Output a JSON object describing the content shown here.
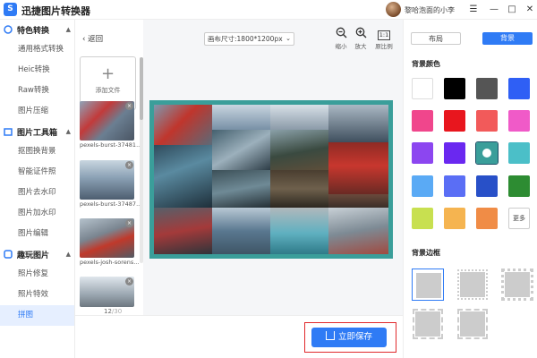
{
  "app": {
    "title": "迅捷图片转换器",
    "logo_text": "S",
    "username": "黎哈泡面的小李"
  },
  "window_controls": [
    "—",
    "□",
    "✕",
    "☰"
  ],
  "sidebar": {
    "groups": [
      {
        "label": "特色转换",
        "items": [
          "通用格式转换",
          "Heic转换",
          "Raw转换",
          "图片压缩"
        ]
      },
      {
        "label": "图片工具箱",
        "items": [
          "抠图换背景",
          "智能证件照",
          "图片去水印",
          "图片加水印",
          "图片编辑"
        ]
      },
      {
        "label": "趣玩图片",
        "items": [
          "照片修复",
          "照片特效",
          "拼图"
        ]
      }
    ],
    "active_item": "拼图"
  },
  "files": {
    "back_label": "返回",
    "add_label": "添加文件",
    "thumbnails": [
      {
        "name": "pexels-burst-37481..."
      },
      {
        "name": "pexels-burst-37487..."
      },
      {
        "name": "pexels-josh-sorens..."
      },
      {
        "name": ""
      }
    ],
    "current": "12",
    "total": "/30"
  },
  "canvas": {
    "size_label": "画布尺寸:1800*1200px",
    "tools": [
      {
        "icon": "zoom-out-icon",
        "label": "缩小"
      },
      {
        "icon": "zoom-in-icon",
        "label": "放大"
      },
      {
        "icon": "ratio-icon",
        "label": "原比例",
        "glyph": "1:1"
      }
    ],
    "border_color": "#3a9e9a"
  },
  "save_button": "立即保存",
  "right_panel": {
    "tabs": [
      "布局",
      "背景"
    ],
    "active_tab": "背景",
    "bg_color_title": "背景颜色",
    "colors": [
      "#ffffff",
      "#000000",
      "#555555",
      "#2f5ff5",
      "#f0468c",
      "#e8161e",
      "#f25a5a",
      "#f05ac8",
      "#8c46f0",
      "#6a28f0",
      "#3a9e9a",
      "#4bbfc8",
      "#5aaaf5",
      "#5a6ef5",
      "#2850c8",
      "#2d8c32",
      "#c8e050",
      "#f5b450",
      "#f08c46"
    ],
    "more_label": "更多",
    "bg_border_title": "背景边框"
  }
}
